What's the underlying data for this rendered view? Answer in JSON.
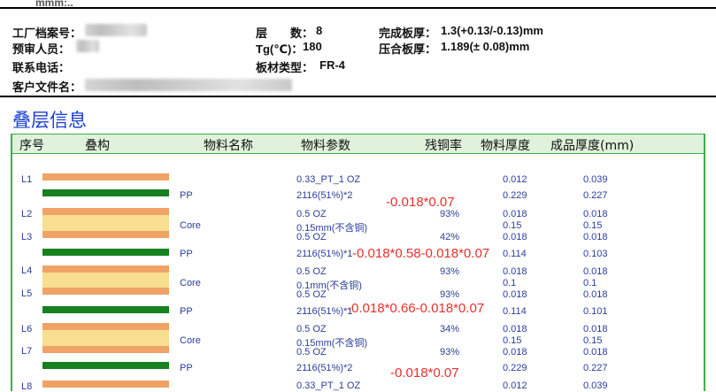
{
  "header": {
    "top_partial": "mmm:..",
    "factory_no_label": "工厂档案号：",
    "reviewer_label": "预审人员：",
    "phone_label": "联系电话：",
    "customer_file_label": "客户文件名：",
    "layers_label": "层　　数：",
    "layers_value": "8",
    "tg_label": "Tg(℃)：",
    "tg_value": "180",
    "board_type_label": "板材类型：",
    "board_type_value": "FR-4",
    "finished_thickness_label": "完成板厚：",
    "finished_thickness_value": "1.3(+0.13/-0.13)mm",
    "press_thickness_label": "压合板厚：",
    "press_thickness_value": "1.189(± 0.08)mm"
  },
  "section_title": "叠层信息",
  "columns": [
    "序号",
    "叠构",
    "物料名称",
    "物料参数",
    "残铜率",
    "物料厚度",
    "成品厚度(mm)"
  ],
  "layer_labels": [
    "L1",
    "L2",
    "L3",
    "L4",
    "L5",
    "L6",
    "L7",
    "L8"
  ],
  "materials": [
    {
      "name": "",
      "param": "0.33_PT_1 OZ",
      "copper": "",
      "mat": "0.012",
      "fin": "0.039"
    },
    {
      "name": "PP",
      "param": "2116(51%)*2",
      "copper": "",
      "mat": "0.229",
      "fin": "0.227"
    },
    {
      "name": "",
      "param": "0.5 OZ",
      "copper": "93%",
      "mat": "0.018",
      "fin": "0.018"
    },
    {
      "name": "Core",
      "param": "0.15mm(不含铜)",
      "copper": "",
      "mat": "0.15",
      "fin": "0.15"
    },
    {
      "name": "",
      "param": "0.5 OZ",
      "copper": "42%",
      "mat": "0.018",
      "fin": "0.018"
    },
    {
      "name": "PP",
      "param": "2116(51%)*1",
      "copper": "",
      "mat": "0.114",
      "fin": "0.103"
    },
    {
      "name": "",
      "param": "0.5 OZ",
      "copper": "93%",
      "mat": "0.018",
      "fin": "0.018"
    },
    {
      "name": "Core",
      "param": "0.1mm(不含铜)",
      "copper": "",
      "mat": "0.1",
      "fin": "0.1"
    },
    {
      "name": "",
      "param": "0.5 OZ",
      "copper": "93%",
      "mat": "0.018",
      "fin": "0.018"
    },
    {
      "name": "PP",
      "param": "2116(51%)*1",
      "copper": "",
      "mat": "0.114",
      "fin": "0.101"
    },
    {
      "name": "",
      "param": "0.5 OZ",
      "copper": "34%",
      "mat": "0.018",
      "fin": "0.018"
    },
    {
      "name": "Core",
      "param": "0.15mm(不含铜)",
      "copper": "",
      "mat": "0.15",
      "fin": "0.15"
    },
    {
      "name": "",
      "param": "0.5 OZ",
      "copper": "93%",
      "mat": "0.018",
      "fin": "0.018"
    },
    {
      "name": "PP",
      "param": "2116(51%)*2",
      "copper": "",
      "mat": "0.229",
      "fin": "0.227"
    },
    {
      "name": "",
      "param": "0.33_PT_1 OZ",
      "copper": "",
      "mat": "0.012",
      "fin": "0.039"
    }
  ],
  "annotations": [
    "-0.018*0.07",
    "-0.018*0.58-0.018*0.07",
    "-0.018*0.66-0.018*0.07",
    "-0.018*0.07"
  ],
  "colors": {
    "copper": "#f0a366",
    "prepreg": "#17801f",
    "core": "#f8df90",
    "title": "#1a3fd0",
    "border": "#3cb043",
    "annotation": "#e8302a"
  }
}
